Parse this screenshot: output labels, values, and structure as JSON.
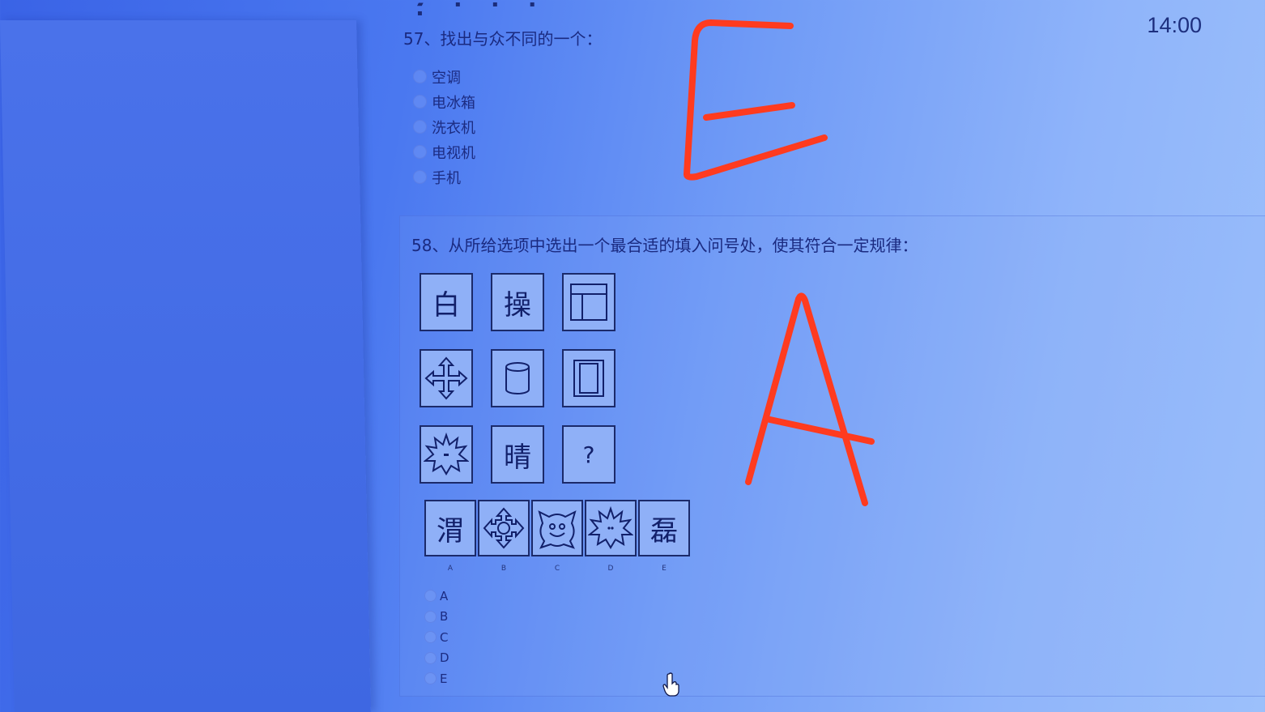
{
  "clock": "14:00",
  "q57": {
    "title": "57、找出与众不同的一个：",
    "options": [
      "空调",
      "电冰箱",
      "洗衣机",
      "电视机",
      "手机"
    ]
  },
  "q58": {
    "title": "58、从所给选项中选出一个最合适的填入问号处，使其符合一定规律：",
    "grid": [
      {
        "text": "白"
      },
      {
        "text": "操"
      },
      {
        "icon": "window-frame-icon"
      },
      {
        "icon": "four-arrows-icon"
      },
      {
        "icon": "cylinder-icon"
      },
      {
        "icon": "double-rectangle-icon"
      },
      {
        "icon": "starburst-icon"
      },
      {
        "text": "晴"
      },
      {
        "text": "?"
      }
    ],
    "answer_figures": [
      {
        "letter": "A",
        "text": "渭"
      },
      {
        "letter": "B",
        "icon": "arrows-circle-icon"
      },
      {
        "letter": "C",
        "icon": "smiley-star-icon"
      },
      {
        "letter": "D",
        "icon": "starburst-dots-icon"
      },
      {
        "letter": "E",
        "text": "磊"
      }
    ],
    "options": [
      "A",
      "B",
      "C",
      "D",
      "E"
    ]
  },
  "handwriting": {
    "q57_answer": "E",
    "q58_answer": "A",
    "color": "#ff3b1f"
  },
  "colors": {
    "text": "#1a2a80",
    "figure_border": "#1b2a6a",
    "figure_fill": "#8fb0f7"
  }
}
